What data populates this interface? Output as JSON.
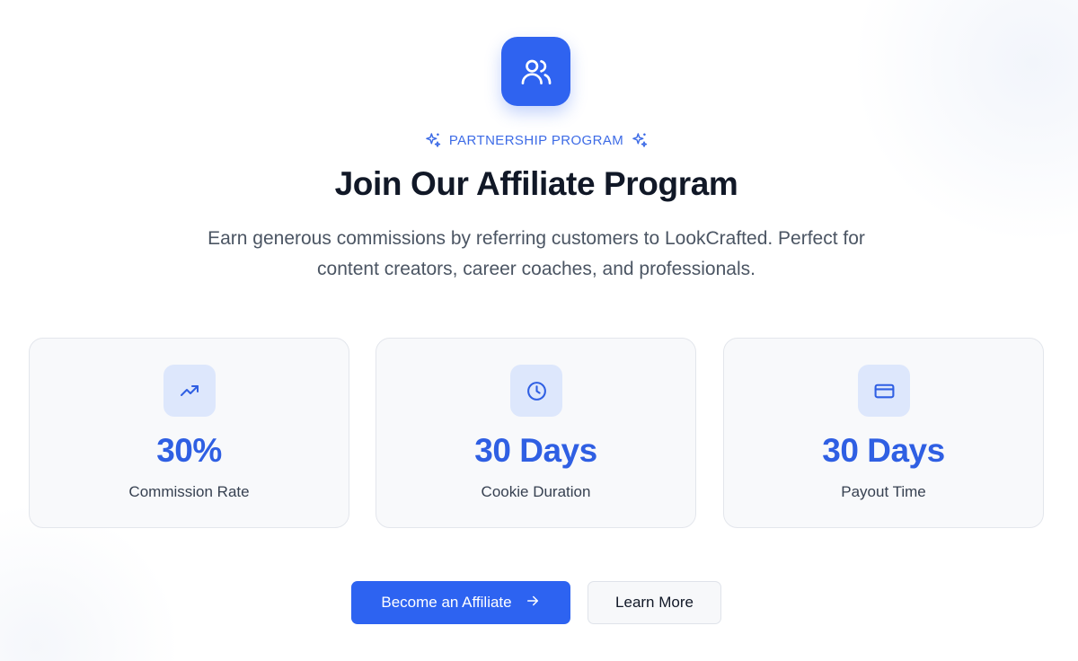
{
  "hero": {
    "icon": "users-icon",
    "eyebrow": "PARTNERSHIP PROGRAM",
    "eyebrow_icon": "sparkles-icon",
    "title": "Join Our Affiliate Program",
    "subtitle": "Earn generous commissions by referring customers to LookCrafted. Perfect for content creators, career coaches, and professionals."
  },
  "stats": [
    {
      "icon": "trending-up-icon",
      "value": "30%",
      "label": "Commission Rate"
    },
    {
      "icon": "clock-icon",
      "value": "30 Days",
      "label": "Cookie Duration"
    },
    {
      "icon": "credit-card-icon",
      "value": "30 Days",
      "label": "Payout Time"
    }
  ],
  "actions": {
    "primary_label": "Become an Affiliate",
    "primary_icon": "arrow-right-icon",
    "secondary_label": "Learn More"
  },
  "colors": {
    "accent": "#2f63f0",
    "icon_tile": "#dde7fc",
    "heading": "#111827",
    "body": "#4b5563"
  }
}
